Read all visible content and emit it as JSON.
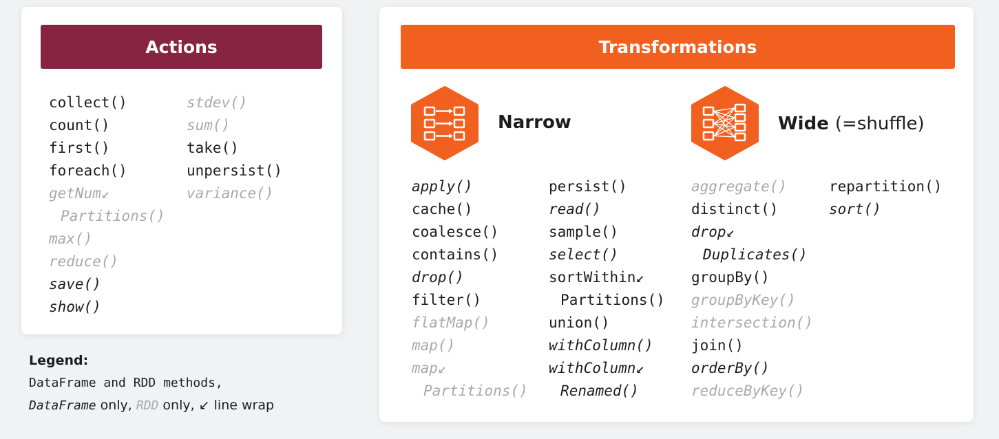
{
  "colors": {
    "actions": "#862441",
    "transformations": "#f2601f",
    "gray_text": "#a8a9ad"
  },
  "actions": {
    "title": "Actions",
    "col1": [
      {
        "text": "collect()",
        "kind": "both"
      },
      {
        "text": "count()",
        "kind": "both"
      },
      {
        "text": "first()",
        "kind": "both"
      },
      {
        "text": "foreach()",
        "kind": "both"
      },
      {
        "text": "getNum↙",
        "kind": "rdd"
      },
      {
        "text": "Partitions()",
        "kind": "rdd",
        "wrap": true
      },
      {
        "text": "max()",
        "kind": "rdd"
      },
      {
        "text": "reduce()",
        "kind": "rdd"
      },
      {
        "text": "save()",
        "kind": "df"
      },
      {
        "text": "show()",
        "kind": "df"
      }
    ],
    "col2": [
      {
        "text": "stdev()",
        "kind": "rdd"
      },
      {
        "text": "sum()",
        "kind": "rdd"
      },
      {
        "text": "take()",
        "kind": "both"
      },
      {
        "text": "unpersist()",
        "kind": "both"
      },
      {
        "text": "variance()",
        "kind": "rdd"
      }
    ]
  },
  "transformations": {
    "title": "Transformations",
    "narrow": {
      "title": "Narrow",
      "icon": "narrow-dependency-icon",
      "col1": [
        {
          "text": "apply()",
          "kind": "df"
        },
        {
          "text": "cache()",
          "kind": "both"
        },
        {
          "text": "coalesce()",
          "kind": "both"
        },
        {
          "text": "contains()",
          "kind": "both"
        },
        {
          "text": "drop()",
          "kind": "df"
        },
        {
          "text": "filter()",
          "kind": "both"
        },
        {
          "text": "flatMap()",
          "kind": "rdd"
        },
        {
          "text": "map()",
          "kind": "rdd"
        },
        {
          "text": "map↙",
          "kind": "rdd"
        },
        {
          "text": "Partitions()",
          "kind": "rdd",
          "wrap": true
        }
      ],
      "col2": [
        {
          "text": "persist()",
          "kind": "both"
        },
        {
          "text": "read()",
          "kind": "df"
        },
        {
          "text": "sample()",
          "kind": "both"
        },
        {
          "text": "select()",
          "kind": "df"
        },
        {
          "text": "sortWithin↙",
          "kind": "both"
        },
        {
          "text": "Partitions()",
          "kind": "both",
          "wrap": true
        },
        {
          "text": "union()",
          "kind": "both"
        },
        {
          "text": "withColumn()",
          "kind": "df"
        },
        {
          "text": "withColumn↙",
          "kind": "df"
        },
        {
          "text": "Renamed()",
          "kind": "df",
          "wrap": true
        }
      ]
    },
    "wide": {
      "title": "Wide",
      "note": "(=shuffle)",
      "icon": "wide-shuffle-icon",
      "col1": [
        {
          "text": "aggregate()",
          "kind": "rdd"
        },
        {
          "text": "distinct()",
          "kind": "both"
        },
        {
          "text": "drop↙",
          "kind": "df"
        },
        {
          "text": "Duplicates()",
          "kind": "df",
          "wrap": true
        },
        {
          "text": "groupBy()",
          "kind": "both"
        },
        {
          "text": "groupByKey()",
          "kind": "rdd"
        },
        {
          "text": "intersection()",
          "kind": "rdd"
        },
        {
          "text": "join()",
          "kind": "both"
        },
        {
          "text": "orderBy()",
          "kind": "df"
        },
        {
          "text": "reduceByKey()",
          "kind": "rdd"
        }
      ],
      "col2": [
        {
          "text": "repartition()",
          "kind": "both"
        },
        {
          "text": "sort()",
          "kind": "df"
        }
      ]
    }
  },
  "legend": {
    "title": "Legend:",
    "line1_code": "DataFrame and RDD methods,",
    "df_code": "DataFrame",
    "df_suffix": " only, ",
    "rdd_code": "RDD",
    "rdd_suffix": " only, ",
    "wrap_symbol": "↙",
    "wrap_text": " line wrap"
  }
}
